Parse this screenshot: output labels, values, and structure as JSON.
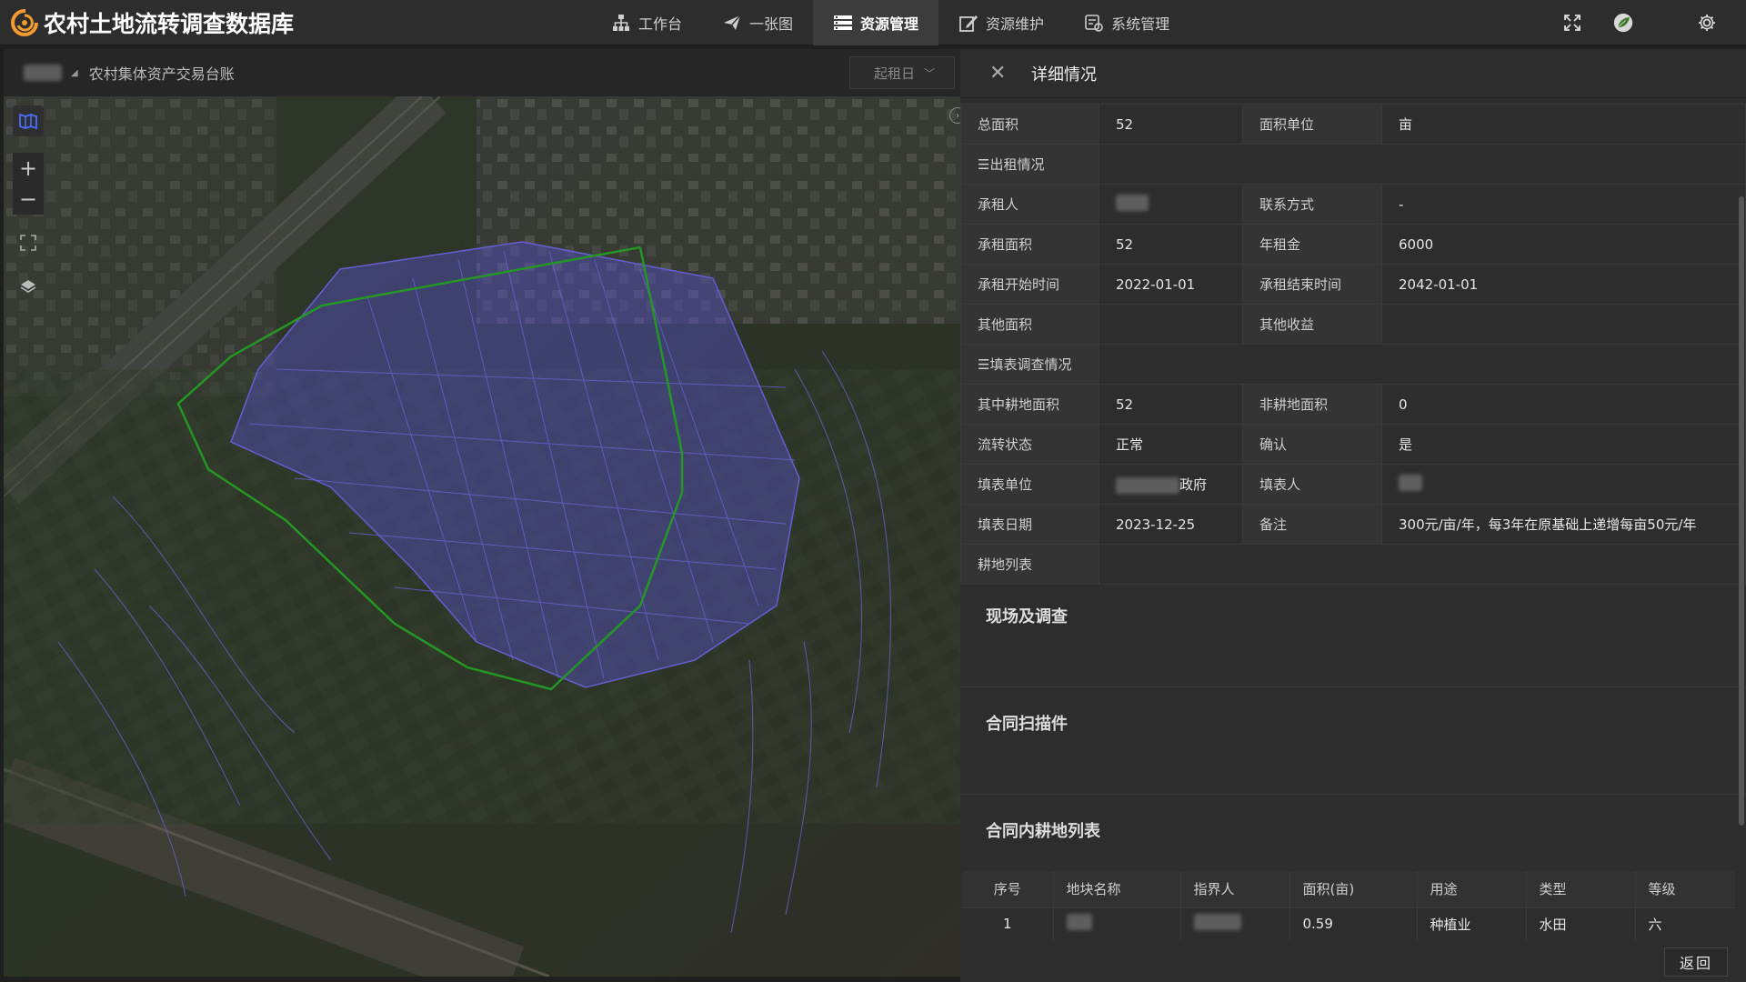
{
  "app": {
    "title": "农村土地流转调查数据库",
    "logo_icon": "swirl-logo-icon",
    "accent": "#f29b30"
  },
  "nav": {
    "items": [
      {
        "label": "工作台",
        "icon": "org-chart-icon",
        "active": false
      },
      {
        "label": "一张图",
        "icon": "paper-plane-icon",
        "active": false
      },
      {
        "label": "资源管理",
        "icon": "list-icon",
        "active": true
      },
      {
        "label": "资源维护",
        "icon": "edit-icon",
        "active": false
      },
      {
        "label": "系统管理",
        "icon": "settings-panel-icon",
        "active": false
      }
    ]
  },
  "topright": {
    "fullscreen_icon": "fullscreen-icon",
    "avatar_icon": "leaf-avatar-icon",
    "settings_icon": "gear-icon"
  },
  "map": {
    "breadcrumb_current": "农村集体资产交易台账",
    "date_filter": "起租日",
    "tools": [
      "layers-map-icon",
      "zoom-in-icon",
      "zoom-out-icon",
      "fullscreen-extent-icon",
      "layers-icon"
    ],
    "tool_glyphs": {
      "zoom_in": "+",
      "zoom_out": "−"
    },
    "parcel_color": "#6c63ff",
    "boundary_color": "#2eb82e"
  },
  "detail": {
    "title": "详细情况",
    "rows": [
      {
        "l1": "总面积",
        "v1": "52",
        "l2": "面积单位",
        "v2": "亩"
      },
      {
        "section": "出租情况"
      },
      {
        "l1": "承租人",
        "v1": "",
        "l2": "联系方式",
        "v2": "-"
      },
      {
        "l1": "承租面积",
        "v1": "52",
        "l2": "年租金",
        "v2": "6000"
      },
      {
        "l1": "承租开始时间",
        "v1": "2022-01-01",
        "l2": "承租结束时间",
        "v2": "2042-01-01"
      },
      {
        "l1": "其他面积",
        "v1": "",
        "l2": "其他收益",
        "v2": ""
      },
      {
        "section": "填表调查情况"
      },
      {
        "l1": "其中耕地面积",
        "v1": "52",
        "l2": "非耕地面积",
        "v2": "0"
      },
      {
        "l1": "流转状态",
        "v1": "正常",
        "l2": "确认",
        "v2": "是"
      },
      {
        "l1": "填表单位",
        "v1": "政府",
        "l2": "填表人",
        "v2": ""
      },
      {
        "l1": "填表日期",
        "v1": "2023-12-25",
        "l2": "备注",
        "v2": "300元/亩/年，每3年在原基础上递增每亩50元/年"
      },
      {
        "l1": "耕地列表",
        "v1": "",
        "l2": "",
        "v2": ""
      }
    ],
    "sections": [
      "现场及调查",
      "合同扫描件",
      "合同内耕地列表"
    ],
    "parcel_table": {
      "headers": [
        "序号",
        "地块名称",
        "指界人",
        "面积(亩)",
        "用途",
        "类型",
        "等级"
      ],
      "rows": [
        [
          "1",
          "",
          "",
          "0.59",
          "种植业",
          "水田",
          "六"
        ]
      ]
    },
    "back_label": "返回"
  }
}
